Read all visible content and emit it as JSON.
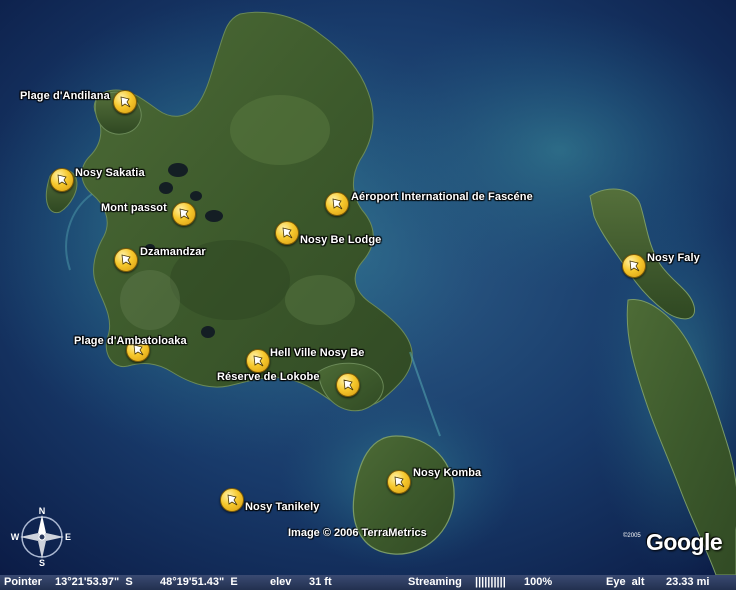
{
  "map": {
    "places": [
      {
        "id": "plage-andilana",
        "label": "Plage d'Andilana"
      },
      {
        "id": "nosy-sakatia",
        "label": "Nosy Sakatia"
      },
      {
        "id": "mont-passot",
        "label": "Mont passot"
      },
      {
        "id": "aeroport",
        "label": "Aéroport International de Fascéne"
      },
      {
        "id": "nosy-be-lodge",
        "label": "Nosy Be Lodge"
      },
      {
        "id": "dzamandzar",
        "label": "Dzamandzar"
      },
      {
        "id": "nosy-faly",
        "label": "Nosy Faly"
      },
      {
        "id": "plage-ambatoloaka",
        "label": "Plage d'Ambatoloaka"
      },
      {
        "id": "hell-ville",
        "label": "Hell Ville Nosy Be"
      },
      {
        "id": "reserve-lokobe",
        "label": "Réserve de Lokobe"
      },
      {
        "id": "nosy-komba",
        "label": "Nosy Komba"
      },
      {
        "id": "nosy-tanikely",
        "label": "Nosy Tanikely"
      }
    ],
    "pin_icon": "placemark-icon",
    "credit": "Image © 2006 TerraMetrics",
    "logo_year": "©2005",
    "logo": "Google",
    "compass": {
      "n": "N",
      "s": "S",
      "e": "E",
      "w": "W"
    }
  },
  "status_bar": {
    "pointer_label": "Pointer",
    "lat": "13°21'53.97\"  S",
    "lon": "48°19'51.43\"  E",
    "elev_label": "elev",
    "elev_value": "31 ft",
    "streaming_label": "Streaming",
    "streaming_bar": "||||||||||",
    "streaming_pct": "100%",
    "eye_label": "Eye  alt",
    "eye_value": "23.33 mi"
  },
  "colors": {
    "ocean_deep": "#0b1b45",
    "ocean_shallow": "#2a6f8a",
    "land": "#3f5a2e",
    "pin": "#f6c82c",
    "status_bar": "#2b3a5e"
  }
}
